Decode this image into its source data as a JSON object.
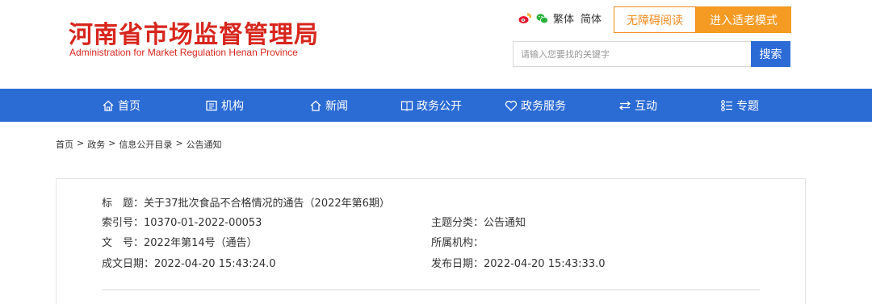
{
  "header": {
    "logo_cn": "河南省市场监督管理局",
    "logo_en": "Administration for Market Regulation Henan Province",
    "lang_traditional": "繁体",
    "lang_simplified": "简体",
    "accessible_label": "无障碍阅读",
    "elderly_label": "进入适老模式",
    "brand_color": "#d7261d",
    "accent_color": "#f59a23"
  },
  "search": {
    "placeholder": "请输入您要找的关键字",
    "button_label": "搜索"
  },
  "nav": {
    "items": [
      {
        "label": "首页",
        "icon": "home-icon"
      },
      {
        "label": "机构",
        "icon": "org-icon"
      },
      {
        "label": "新闻",
        "icon": "news-icon"
      },
      {
        "label": "政务公开",
        "icon": "gov-open-icon"
      },
      {
        "label": "政务服务",
        "icon": "heart-icon"
      },
      {
        "label": "互动",
        "icon": "exchange-icon"
      },
      {
        "label": "专题",
        "icon": "topic-icon"
      }
    ],
    "color": "#2b6bd4"
  },
  "breadcrumb": {
    "items": [
      "首页",
      "政务",
      "信息公开目录",
      "公告通知"
    ],
    "separator": ">"
  },
  "info": {
    "title_label": "标　题：",
    "title_value": "关于37批次食品不合格情况的通告（2022年第6期）",
    "index_label": "索引号：",
    "index_value": "10370-01-2022-00053",
    "category_label": "主题分类：",
    "category_value": "公告通知",
    "docno_label": "文　号：",
    "docno_value": "2022年第14号（通告）",
    "org_label": "所属机构：",
    "org_value": "",
    "created_label": "成文日期：",
    "created_value": "2022-04-20 15:43:24.0",
    "published_label": "发布日期：",
    "published_value": "2022-04-20 15:43:33.0"
  }
}
